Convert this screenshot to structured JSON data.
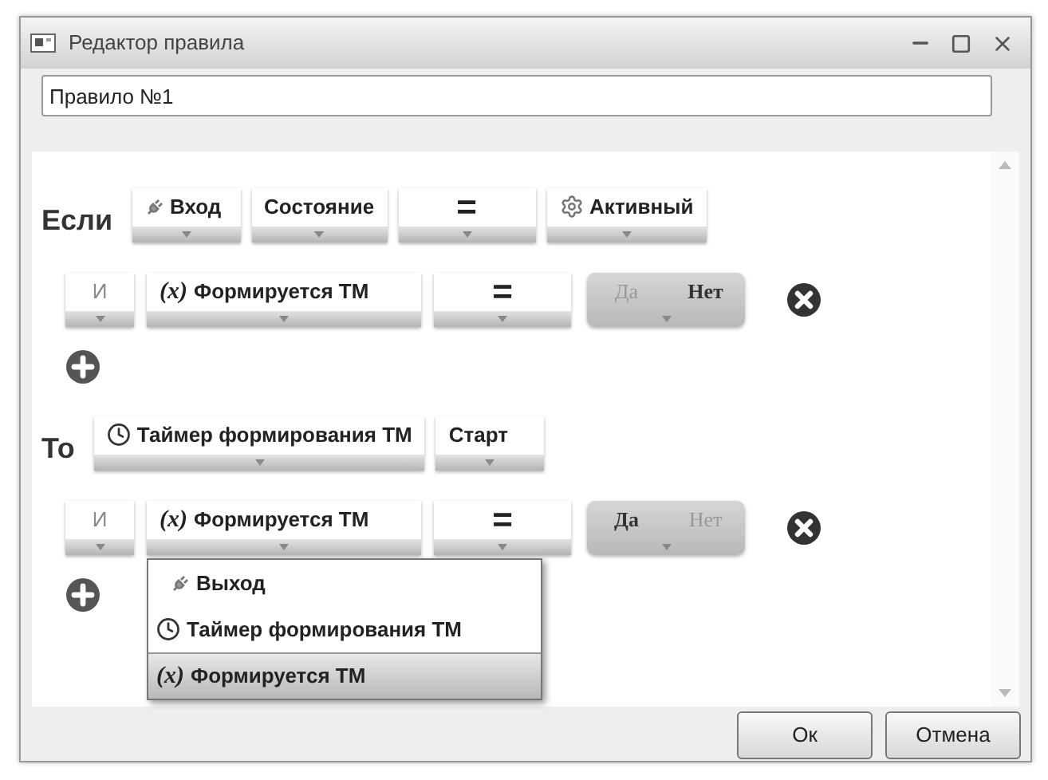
{
  "window": {
    "title": "Редактор правила"
  },
  "rule_name": {
    "value": "Правило №1"
  },
  "sections": [
    {
      "label": "Если",
      "selectors": [
        {
          "kind": "plug",
          "text": "Вход"
        },
        {
          "kind": "text",
          "text": "Состояние"
        },
        {
          "kind": "operator",
          "text": "="
        },
        {
          "kind": "gear",
          "text": "Активный"
        }
      ],
      "conditions": [
        {
          "connector": "И",
          "variable": {
            "kind": "variable",
            "prefix": "(x)",
            "text": "Формируется ТМ"
          },
          "operator": "=",
          "toggle": [
            {
              "label": "Да",
              "selected": false
            },
            {
              "label": "Нет",
              "selected": true
            }
          ]
        }
      ]
    },
    {
      "label": "То",
      "selectors": [
        {
          "kind": "clock",
          "text": "Таймер формирования ТМ"
        },
        {
          "kind": "text",
          "text": "Старт"
        }
      ],
      "conditions": [
        {
          "connector": "И",
          "variable": {
            "kind": "variable",
            "prefix": "(x)",
            "text": "Формируется ТМ"
          },
          "operator": "=",
          "toggle": [
            {
              "label": "Да",
              "selected": true
            },
            {
              "label": "Нет",
              "selected": false
            }
          ],
          "menu": [
            {
              "kind": "plug",
              "text": "Выход",
              "selected": false
            },
            {
              "kind": "clock",
              "text": "Таймер формирования ТМ",
              "selected": false
            },
            {
              "kind": "variable",
              "prefix": "(x)",
              "text": "Формируется ТМ",
              "selected": true
            }
          ]
        }
      ]
    }
  ],
  "buttons": [
    "Ок",
    "Отмена"
  ]
}
